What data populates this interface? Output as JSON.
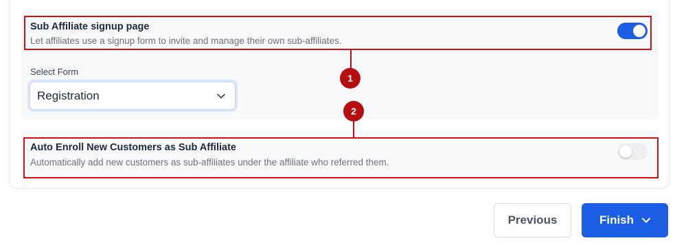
{
  "settings": {
    "sub_affiliate_signup": {
      "title": "Sub Affiliate signup page",
      "description": "Let affiliates use a signup form to invite and manage their own sub-affiliates.",
      "enabled": true
    },
    "select_form": {
      "label": "Select Form",
      "value": "Registration"
    },
    "auto_enroll": {
      "title": "Auto Enroll New Customers as Sub Affiliate",
      "description": "Automatically add new customers as sub-affiliates under the affiliate who referred them.",
      "enabled": false
    }
  },
  "annotations": {
    "badge_1": "1",
    "badge_2": "2",
    "highlight_color": "#d40e13"
  },
  "footer": {
    "previous_label": "Previous",
    "finish_label": "Finish"
  },
  "colors": {
    "accent": "#1c5ee3"
  }
}
